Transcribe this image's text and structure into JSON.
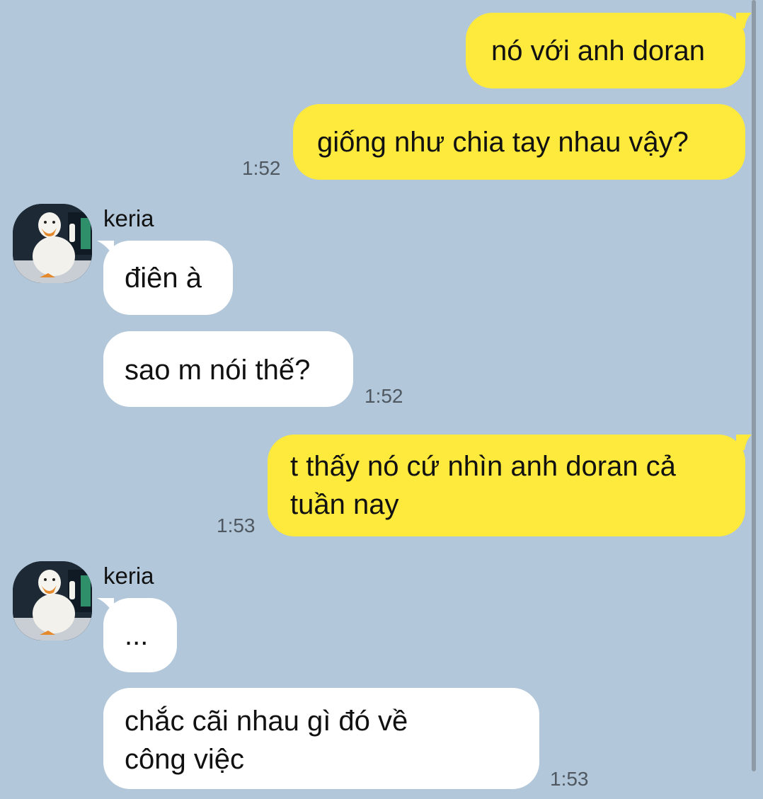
{
  "colors": {
    "background": "#b2c7d9",
    "outgoing_bubble": "#fee93d",
    "incoming_bubble": "#ffffff",
    "timestamp": "#4f5861"
  },
  "messages": [
    {
      "direction": "out",
      "text": "nó với anh doran"
    },
    {
      "direction": "out",
      "text": "giống như chia tay nhau vậy?",
      "time": "1:52"
    },
    {
      "direction": "in",
      "sender": "keria",
      "text": "điên à"
    },
    {
      "direction": "in",
      "text": "sao m nói thế?",
      "time": "1:52"
    },
    {
      "direction": "out",
      "text_line1": "t thấy nó cứ nhìn anh doran cả",
      "text_line2": "tuần nay",
      "time": "1:53"
    },
    {
      "direction": "in",
      "sender": "keria",
      "text": "..."
    },
    {
      "direction": "in",
      "text_line1": "chắc cãi nhau gì đó về",
      "text_line2": "công việc",
      "time": "1:53"
    }
  ],
  "avatar": {
    "icon": "duck-avatar-icon"
  }
}
